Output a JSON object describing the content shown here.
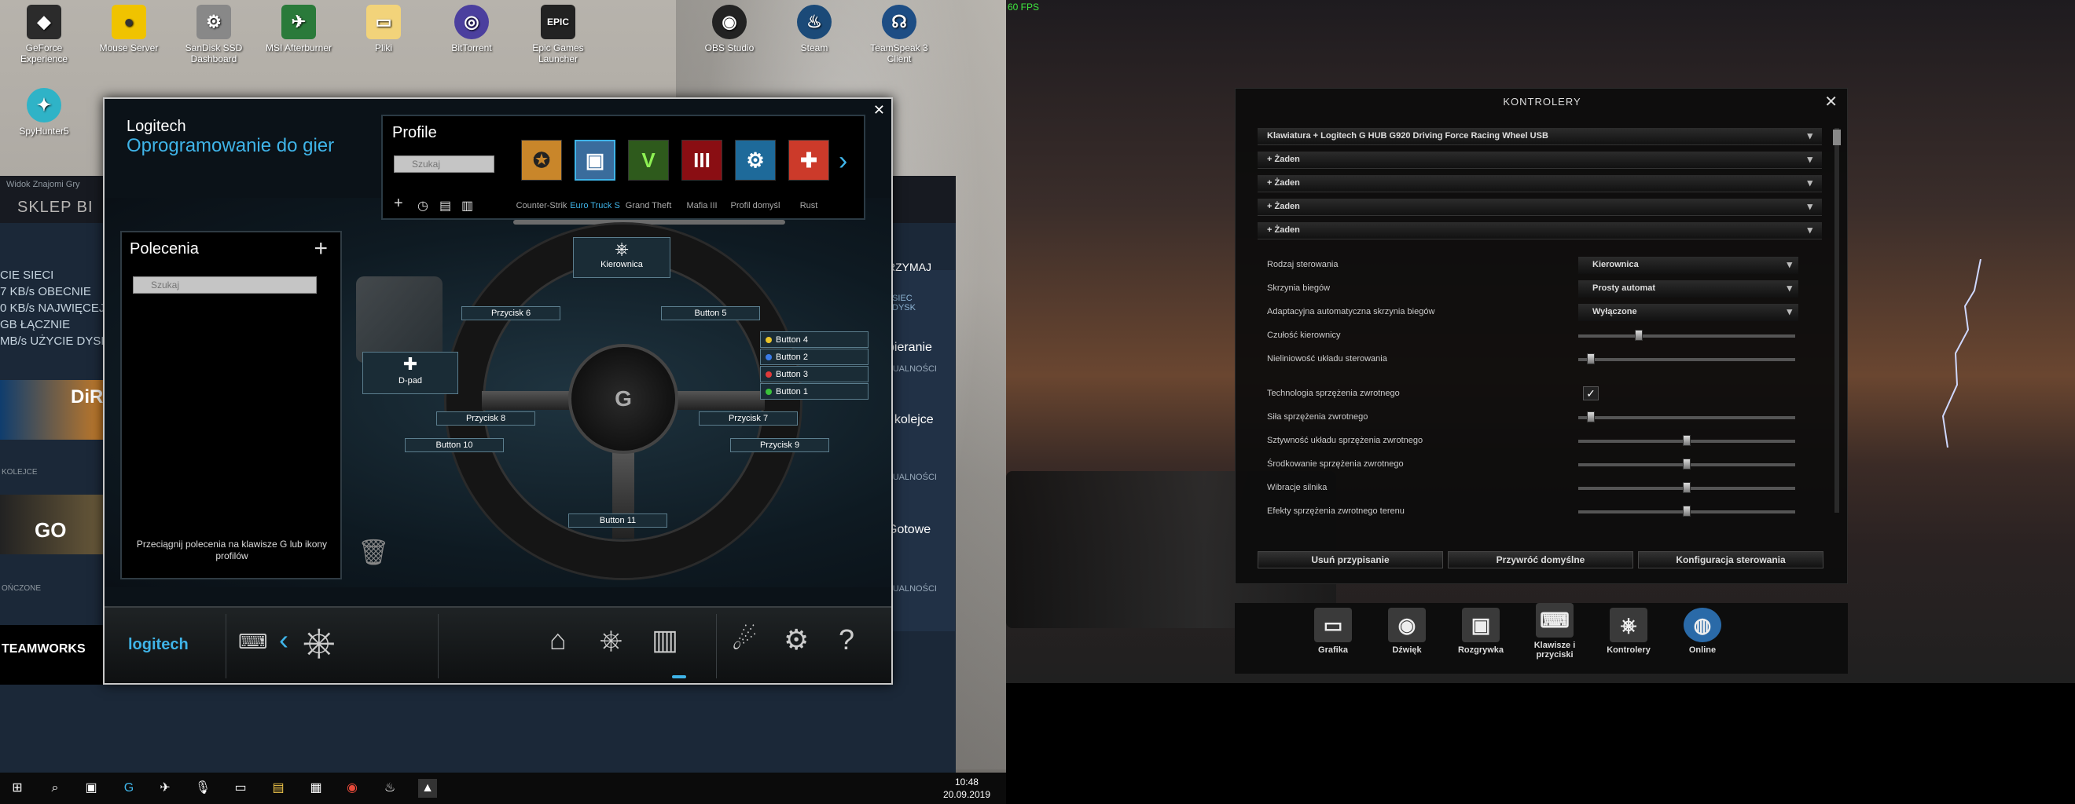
{
  "desktop": {
    "icons_row1": [
      "GeForce Experience",
      "Mouse Server",
      "SanDisk SSD Dashboard",
      "MSI Afterburner",
      "Pliki",
      "BitTorrent",
      "Epic Games Launcher",
      "OBS Studio",
      "Steam",
      "TeamSpeak 3 Client"
    ],
    "icons_row2": [
      "SpyHunter5"
    ]
  },
  "steam_bg": {
    "menu": "Widok  Znajomi  Gry",
    "nav": "SKLEP   BI",
    "stats": [
      "CIE SIECI",
      "7 KB/s OBECNIE",
      "0 KB/s NAJWIĘCEJ",
      "GB ŁĄCZNIE",
      "MB/s UŻYCIE DYSK"
    ],
    "labels": [
      "KOLEJCE",
      "OŃCZONE"
    ],
    "right": [
      "RZYMAJ",
      "SIEC DYSK",
      "bieranie",
      "TUALNOŚCI",
      "/ kolejce",
      "TUALNOŚCI",
      "Gotowe",
      "TUALNOŚCI"
    ],
    "games": [
      "DiRT",
      "GO",
      "TEAMWORKS"
    ]
  },
  "logitech": {
    "brand": "Logitech",
    "subtitle": "Oprogramowanie do gier",
    "profile": {
      "title": "Profile",
      "search_placeholder": "Szukaj",
      "profiles": [
        "Counter-Strik",
        "Euro Truck S",
        "Grand Theft",
        "Mafia III",
        "Profil domyśl",
        "Rust"
      ]
    },
    "commands": {
      "title": "Polecenia",
      "search_placeholder": "Szukaj",
      "hint": "Przeciągnij polecenia na klawisze G lub ikony profilów"
    },
    "callouts": {
      "kierownica": "Kierownica",
      "dpad": "D-pad",
      "p6": "Przycisk 6",
      "b5": "Button 5",
      "p8": "Przycisk 8",
      "p7": "Przycisk 7",
      "b10": "Button 10",
      "p9": "Przycisk 9",
      "b11": "Button 11"
    },
    "buttons": [
      "Button 4",
      "Button 2",
      "Button 3",
      "Button 1"
    ],
    "footer_brand": "logitech"
  },
  "taskbar": {
    "time": "10:48",
    "date": "20.09.2019"
  },
  "game": {
    "fps": "60 FPS",
    "title": "KONTROLERY",
    "device": "Klawiatura + Logitech G HUB G920 Driving Force Racing Wheel USB",
    "none_items": [
      "+ Żaden",
      "+ Żaden",
      "+ Żaden",
      "+ Żaden"
    ],
    "settings": [
      {
        "label": "Rodzaj sterowania",
        "value": "Kierownica"
      },
      {
        "label": "Skrzynia biegów",
        "value": "Prosty automat"
      },
      {
        "label": "Adaptacyjna automatyczna skrzynia biegów",
        "value": "Wyłączone"
      }
    ],
    "sliders": [
      {
        "label": "Czułość kierownicy",
        "level": 0.27
      },
      {
        "label": "Nieliniowość układu sterowania",
        "level": 0.04
      }
    ],
    "ffb_check_label": "Technologia sprzężenia zwrotnego",
    "ffb_sliders": [
      {
        "label": "Siła sprzężenia zwrotnego",
        "level": 0.04
      },
      {
        "label": "Sztywność układu sprzężenia zwrotnego",
        "level": 0.5
      },
      {
        "label": "Środkowanie sprzężenia zwrotnego",
        "level": 0.5
      },
      {
        "label": "Wibracje silnika",
        "level": 0.5
      },
      {
        "label": "Efekty sprzężenia zwrotnego terenu",
        "level": 0.5
      }
    ],
    "buttons": [
      "Usuń przypisanie",
      "Przywróć domyślne",
      "Konfiguracja sterowania"
    ],
    "menu": [
      "Grafika",
      "Dźwięk",
      "Rozgrywka",
      "Klawisze i przyciski",
      "Kontrolery",
      "Online"
    ]
  }
}
